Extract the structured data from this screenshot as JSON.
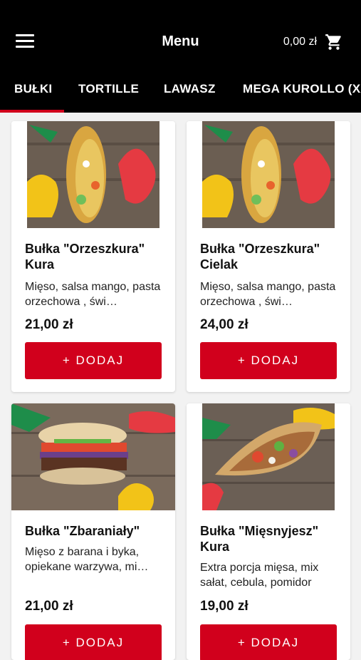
{
  "header": {
    "title": "Menu",
    "cart_total": "0,00 zł"
  },
  "tabs": [
    {
      "label": "BUŁKI"
    },
    {
      "label": "TORTILLE"
    },
    {
      "label": "LAWASZ"
    },
    {
      "label": "MEGA KUROLLO (XXL)"
    }
  ],
  "products": [
    {
      "name": "Bułka \"Orzeszkura\" Kura",
      "description": "Mięso, salsa mango, pasta orzechowa , świ…",
      "price": "21,00 zł",
      "add_label": "+ DODAJ"
    },
    {
      "name": "Bułka \"Orzeszkura\" Cielak",
      "description": "Mięso, salsa mango, pasta orzechowa , świ…",
      "price": "24,00 zł",
      "add_label": "+ DODAJ"
    },
    {
      "name": "Bułka \"Zbaraniały\"",
      "description": "Mięso z barana i byka, opiekane warzywa, mi…",
      "price": "21,00 zł",
      "add_label": "+ DODAJ"
    },
    {
      "name": "Bułka \"Mięsnyjesz\" Kura",
      "description": "Extra porcja mięsa, mix sałat, cebula, pomidor",
      "price": "19,00 zł",
      "add_label": "+ DODAJ"
    }
  ],
  "colors": {
    "accent": "#d1001c",
    "header_bg": "#000000"
  },
  "icons": [
    "hamburger-menu-icon",
    "cart-icon"
  ]
}
